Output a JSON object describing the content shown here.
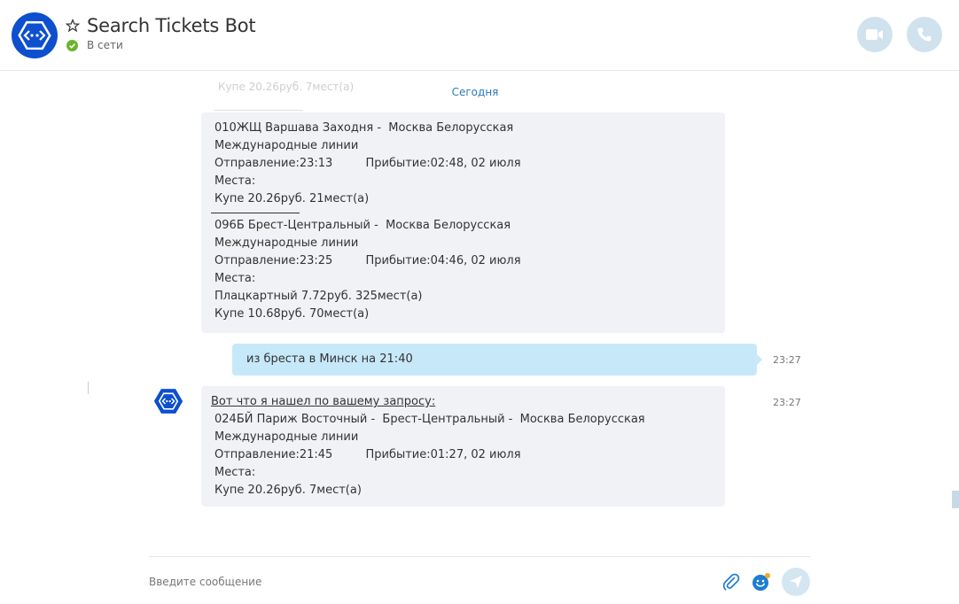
{
  "header": {
    "title": "Search Tickets Bot",
    "status": "В сети",
    "colors": {
      "accent": "#0d4fcf",
      "online": "#6ab42d",
      "call_button": "#cfe2ee"
    },
    "icons": {
      "avatar": "bot-avatar",
      "favorite": "star-outline-icon",
      "status": "online-check-icon",
      "video": "video-call-icon",
      "audio": "phone-call-icon"
    }
  },
  "conversation": {
    "day_separator": "Сегодня",
    "messages": [
      {
        "direction": "incoming",
        "blocks": [
          {
            "lines": [
              "010ЖЩ Варшава Заходня -  Москва Белорусская",
              "Международные линии",
              "Отправление:23:13         Прибытие:02:48, 02 июля",
              "Места:",
              "Купе 20.26руб. 21мест(а)"
            ]
          },
          {
            "lines": [
              "096Б Брест-Центральный -  Москва Белорусская",
              "Международные линии",
              "Отправление:23:25         Прибытие:04:46, 02 июля",
              "Места:",
              "Плацкартный 7.72руб. 325мест(а)",
              "Купе 10.68руб. 70мест(а)"
            ]
          }
        ]
      },
      {
        "direction": "outgoing",
        "text": "из бреста в Минск на 21:40",
        "time": "23:27"
      },
      {
        "direction": "incoming",
        "time": "23:27",
        "intro": "Вот что я нашел по вашему запросу:",
        "lines": [
          "024БЙ Париж Восточный -  Брест-Центральный -  Москва Белорусская",
          "Международные линии",
          "Отправление:21:45         Прибытие:01:27, 02 июля",
          "Места:",
          "Купе 20.26руб. 7мест(а)"
        ]
      }
    ]
  },
  "composer": {
    "placeholder": "Введите сообщение",
    "icons": {
      "attach": "paperclip-icon",
      "emoji": "emoji-icon",
      "send": "send-icon"
    }
  }
}
